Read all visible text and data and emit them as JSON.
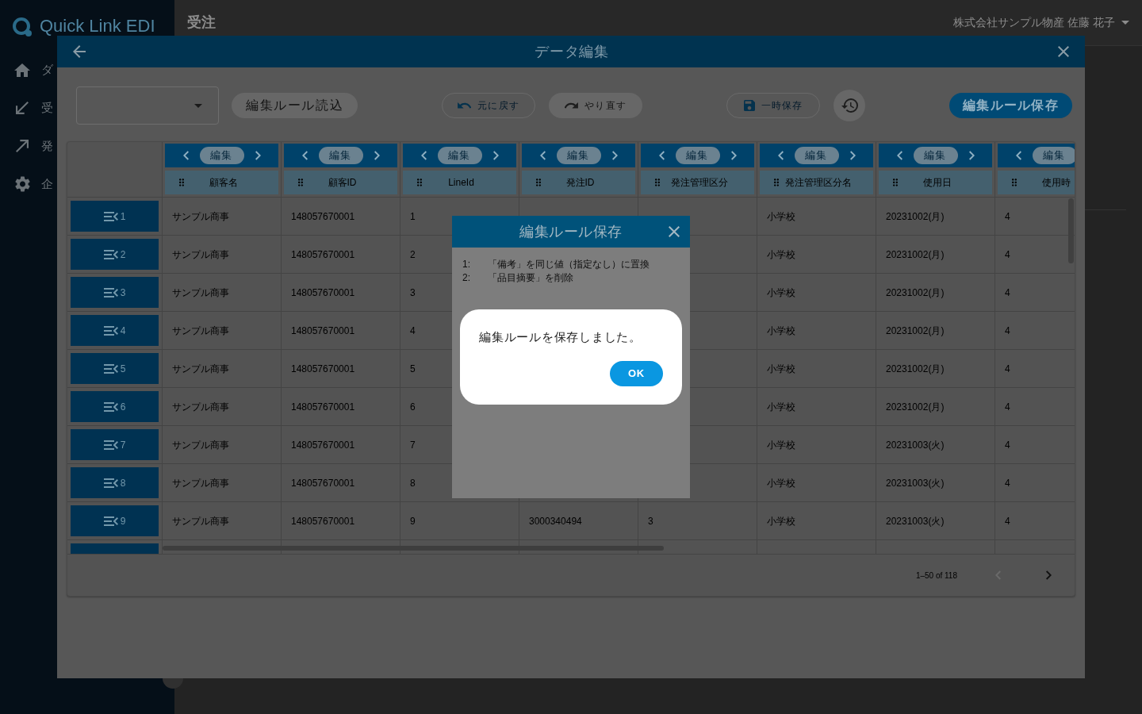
{
  "sidebar": {
    "logo": "Quick Link EDI",
    "items": [
      {
        "label": "ダ"
      },
      {
        "label": "受"
      },
      {
        "label": "発"
      },
      {
        "label": "企"
      }
    ]
  },
  "header": {
    "title": "受注",
    "user": "株式会社サンプル物産 佐藤 花子"
  },
  "data_edit_dialog": {
    "title": "データ編集",
    "toolbar": {
      "load_rules": {
        "label": "編集ルール読込",
        "disabled": true
      },
      "undo": {
        "label": "元に戻す",
        "disabled": false
      },
      "redo": {
        "label": "やり直す",
        "disabled": true
      },
      "temporary_save": {
        "label": "一時保存",
        "disabled": false
      },
      "history": {
        "disabled": true
      },
      "save_rules": {
        "label": "編集ルール保存"
      }
    },
    "table": {
      "columns": [
        {
          "edit": "編集",
          "name": "顧客名"
        },
        {
          "edit": "編集",
          "name": "顧客ID"
        },
        {
          "edit": "編集",
          "name": "LineId"
        },
        {
          "edit": "編集",
          "name": "発注ID"
        },
        {
          "edit": "編集",
          "name": "発注管理区分"
        },
        {
          "edit": "編集",
          "name": "発注管理区分名"
        },
        {
          "edit": "編集",
          "name": "使用日"
        },
        {
          "edit": "編集",
          "name": "使用時"
        }
      ],
      "rows": [
        {
          "number": "1",
          "cells": [
            "サンプル商事",
            "148057670001",
            "1",
            null,
            null,
            "小学校",
            "20231002(月)",
            "4"
          ]
        },
        {
          "number": "2",
          "cells": [
            "サンプル商事",
            "148057670001",
            "2",
            null,
            null,
            "小学校",
            "20231002(月)",
            "4"
          ]
        },
        {
          "number": "3",
          "cells": [
            "サンプル商事",
            "148057670001",
            "3",
            null,
            null,
            "小学校",
            "20231002(月)",
            "4"
          ]
        },
        {
          "number": "4",
          "cells": [
            "サンプル商事",
            "148057670001",
            "4",
            null,
            null,
            "小学校",
            "20231002(月)",
            "4"
          ]
        },
        {
          "number": "5",
          "cells": [
            "サンプル商事",
            "148057670001",
            "5",
            null,
            null,
            "小学校",
            "20231002(月)",
            "4"
          ]
        },
        {
          "number": "6",
          "cells": [
            "サンプル商事",
            "148057670001",
            "6",
            null,
            null,
            "小学校",
            "20231002(月)",
            "4"
          ]
        },
        {
          "number": "7",
          "cells": [
            "サンプル商事",
            "148057670001",
            "7",
            null,
            null,
            "小学校",
            "20231003(火)",
            "4"
          ]
        },
        {
          "number": "8",
          "cells": [
            "サンプル商事",
            "148057670001",
            "8",
            null,
            null,
            "小学校",
            "20231003(火)",
            "4"
          ]
        },
        {
          "number": "9",
          "cells": [
            "サンプル商事",
            "148057670001",
            "9",
            "3000340494",
            "3",
            "小学校",
            "20231003(火)",
            "4"
          ]
        }
      ],
      "more_rows_below": true
    },
    "pagination": {
      "range": "1–50 of 118",
      "previous_disabled": true,
      "next_disabled": false
    }
  },
  "rule_save_dialog": {
    "title": "編集ルール保存",
    "rules": [
      {
        "number": "1:",
        "text": "「備考」を同じ値（指定なし）に置換"
      },
      {
        "number": "2:",
        "text": "「品目摘要」を削除"
      }
    ]
  },
  "alert": {
    "message": "編集ルールを保存しました。",
    "button": "OK"
  }
}
